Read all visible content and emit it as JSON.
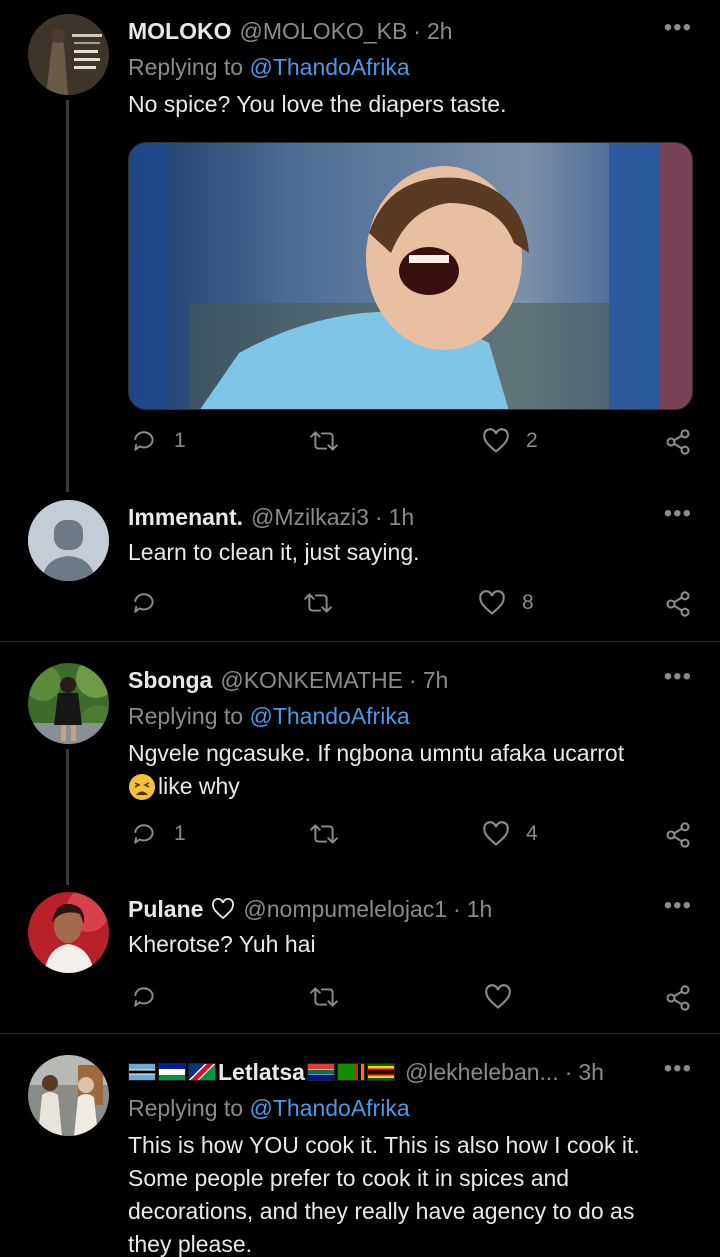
{
  "tweets": [
    {
      "name": "MOLOKO",
      "handle": "@MOLOKO_KB",
      "time": "2h",
      "replying_label": "Replying to",
      "replying_to": "@ThandoAfrika",
      "text": "No spice? You love the diapers taste.",
      "replies": "1",
      "retweets": "",
      "likes": "2"
    },
    {
      "name": "Immenant.",
      "handle": "@Mzilkazi3",
      "time": "1h",
      "text": "Learn to clean it, just saying.",
      "replies": "",
      "retweets": "",
      "likes": "8"
    },
    {
      "name": "Sbonga",
      "handle": "@KONKEMATHE",
      "time": "7h",
      "replying_label": "Replying to",
      "replying_to": "@ThandoAfrika",
      "text_line1": "Ngvele ngcasuke. If ngbona umntu afaka ucarrot",
      "text_line2": "like why",
      "replies": "1",
      "retweets": "",
      "likes": "4"
    },
    {
      "name": "Pulane",
      "handle": "@nompumelelojac1",
      "time": "1h",
      "text": "Kherotse? Yuh hai",
      "replies": "",
      "retweets": "",
      "likes": ""
    },
    {
      "name": "Letlatsa",
      "handle": "@lekheleban...",
      "time": "3h",
      "replying_label": "Replying to",
      "replying_to": "@ThandoAfrika",
      "text_line1": "This is how YOU cook it. This is also how I cook it.",
      "text_line2": "Some people prefer to cook it in spices and",
      "text_line3": "decorations, and they really have agency to do as",
      "text_line4": "they please."
    }
  ],
  "ui": {
    "dot": "·",
    "more": "•••"
  },
  "colors": {
    "background": "#000000",
    "link": "#4a99e9",
    "muted": "#8b8b8b",
    "text": "#e7e9ea"
  },
  "icons": [
    "reply-icon",
    "retweet-icon",
    "like-icon",
    "share-icon",
    "more-icon",
    "heart-outline-icon",
    "weary-face-emoji"
  ]
}
